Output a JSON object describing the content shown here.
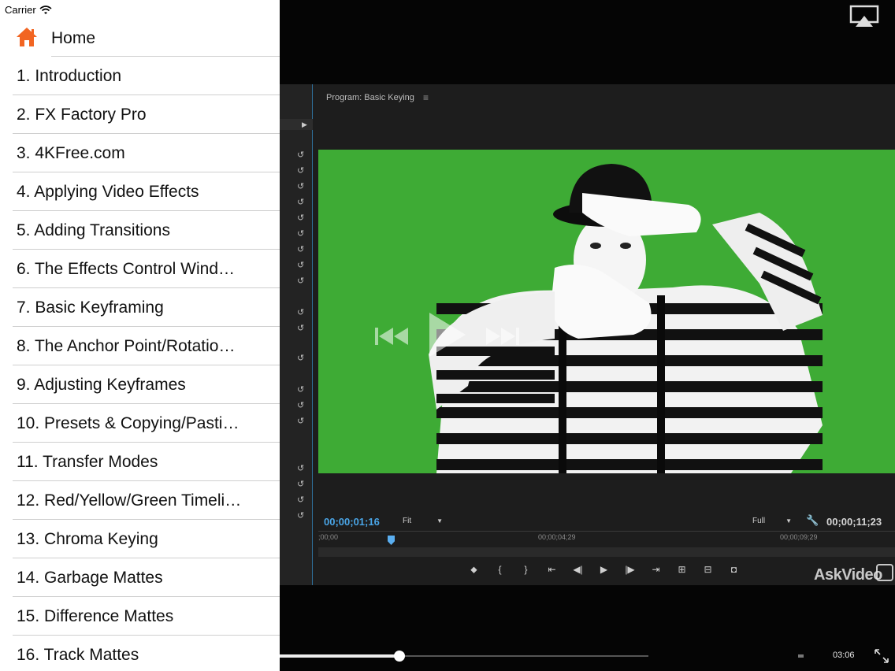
{
  "status_bar": {
    "carrier": "Carrier"
  },
  "home": {
    "label": "Home"
  },
  "menu": [
    "1. Introduction",
    "2. FX Factory Pro",
    "3. 4KFree.com",
    "4. Applying Video Effects",
    "5. Adding Transitions",
    "6. The Effects Control Wind…",
    "7. Basic Keyframing",
    "8. The Anchor Point/Rotatio…",
    "9. Adjusting Keyframes",
    "10. Presets & Copying/Pasti…",
    "11. Transfer Modes",
    "12. Red/Yellow/Green Timeli…",
    "13. Chroma Keying",
    "14. Garbage Mattes",
    "15. Difference Mattes",
    "16. Track Mattes"
  ],
  "editor": {
    "program_title": "Program: Basic Keying",
    "timecode_current": "00;00;01;16",
    "fit_label": "Fit",
    "full_label": "Full",
    "timecode_total": "00;00;11;23",
    "ruler_labels": [
      ";00;00",
      "00;00;04;29",
      "00;00;09;29"
    ]
  },
  "player": {
    "watermark": "AskVideo",
    "time_remaining": "03:06",
    "progress": 0.325
  },
  "colors": {
    "accent_orange": "#f26522",
    "keying_green": "#3eab35",
    "timecode_blue": "#4aa6e8"
  }
}
